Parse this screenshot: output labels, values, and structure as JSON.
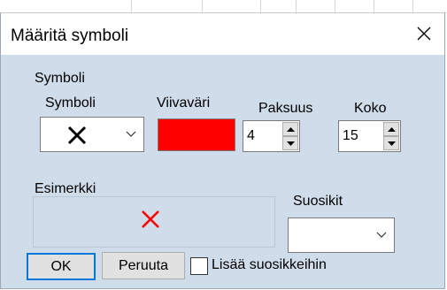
{
  "dialog": {
    "title": "Määritä symboli"
  },
  "symbol_group": {
    "title": "Symboli",
    "symbol_label": "Symboli",
    "line_color_label": "Viivaväri",
    "line_color": "#ff0000",
    "thickness_label": "Paksuus",
    "thickness_value": "4",
    "size_label": "Koko",
    "size_value": "15",
    "selected_symbol": "x-mark-icon"
  },
  "preview": {
    "label": "Esimerkki",
    "symbol_color": "#ff0000"
  },
  "favorites": {
    "label": "Suosikit",
    "selected": ""
  },
  "buttons": {
    "ok": "OK",
    "cancel": "Peruuta",
    "add_favorite": "Lisää suosikkeihin",
    "add_favorite_checked": false
  },
  "colors": {
    "dialog_bg": "#cfdcea",
    "default_button_border": "#0078d7"
  }
}
